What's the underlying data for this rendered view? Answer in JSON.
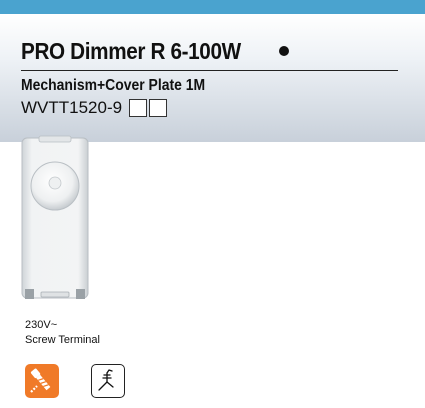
{
  "product": {
    "title": "PRO Dimmer R 6-100W",
    "subtitle": "Mechanism+Cover Plate 1M",
    "code": "WVTT1520-9"
  },
  "specs": {
    "voltage": "230V~",
    "terminal": "Screw Terminal"
  },
  "icons": {
    "screw": "screw-terminal-icon",
    "clamp": "clamp-terminal-icon"
  },
  "colors": {
    "top_band": "#4aa3cf",
    "screw_icon_bg": "#f07a28"
  }
}
